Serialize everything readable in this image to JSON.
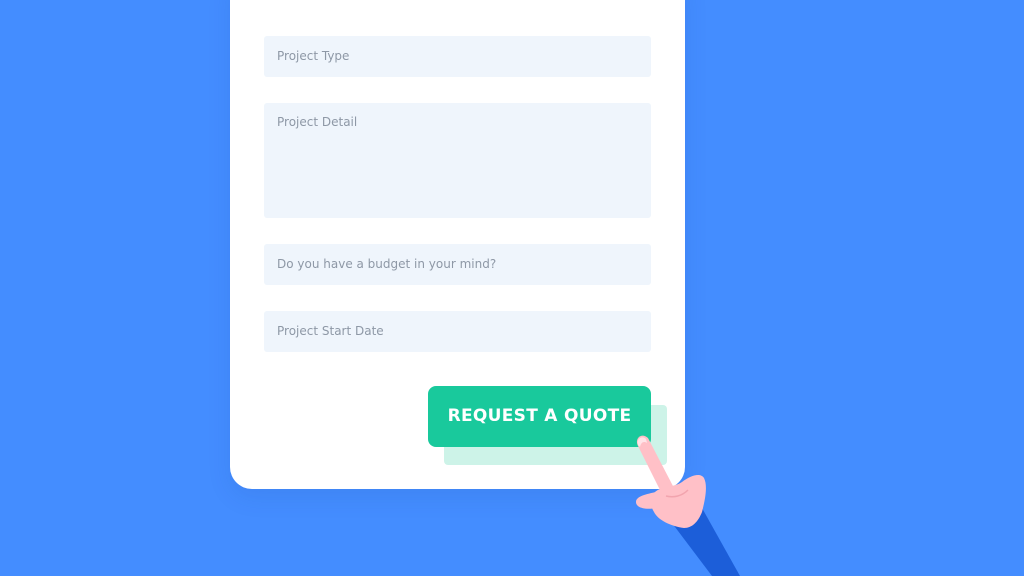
{
  "form": {
    "fields": [
      {
        "placeholder": "Project Type"
      },
      {
        "placeholder": "Project Detail"
      },
      {
        "placeholder": "Do you have a budget in your mind?"
      },
      {
        "placeholder": "Project Start Date"
      }
    ],
    "submit_label": "REQUEST A QUOTE"
  },
  "colors": {
    "background": "#448dff",
    "card": "#ffffff",
    "field_fill": "#eff5fc",
    "button": "#19c99c",
    "button_shadow": "#cdf3e8"
  },
  "icons": {
    "pointer": "pointing-hand-icon"
  }
}
